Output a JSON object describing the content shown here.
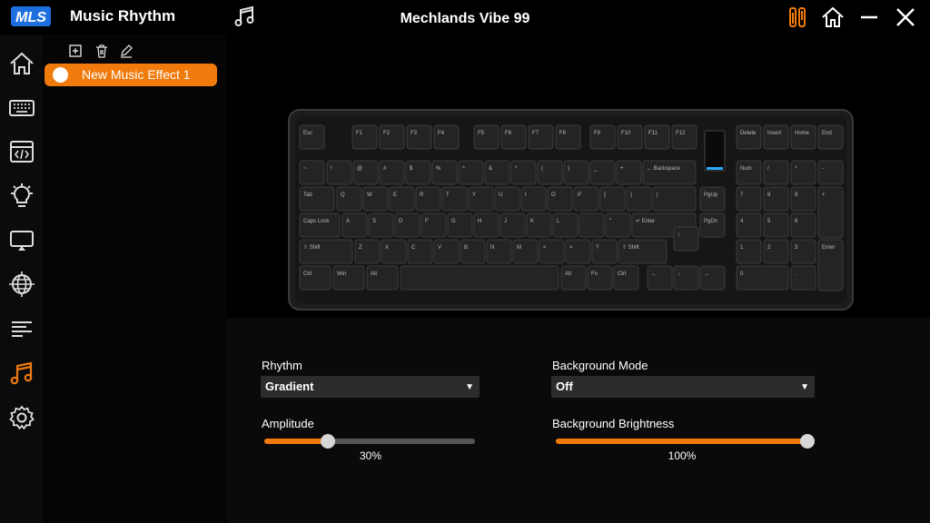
{
  "app": {
    "logo_text": "MLS",
    "title": "Music Rhythm",
    "device_name": "Mechlands Vibe 99"
  },
  "colors": {
    "accent": "#f07a0b",
    "background": "#000000",
    "panel": "#0a0a0a",
    "logo_blue": "#1d6fe0"
  },
  "titlebar": {
    "icons": [
      "music-note-icon",
      "settings-sliders-icon",
      "home-icon",
      "minimize-icon",
      "close-icon"
    ]
  },
  "sidebar": {
    "items": [
      {
        "icon": "home-icon",
        "active": false
      },
      {
        "icon": "keyboard-icon",
        "active": false
      },
      {
        "icon": "macro-code-icon",
        "active": false
      },
      {
        "icon": "light-bulb-icon",
        "active": false
      },
      {
        "icon": "display-icon",
        "active": false
      },
      {
        "icon": "globe-icon",
        "active": false
      },
      {
        "icon": "list-lines-icon",
        "active": false
      },
      {
        "icon": "music-note-icon",
        "active": true
      },
      {
        "icon": "gear-icon",
        "active": false
      }
    ]
  },
  "effects": {
    "tools": [
      "add-icon",
      "delete-icon",
      "edit-icon"
    ],
    "items": [
      {
        "label": "New Music Effect 1",
        "selected": true
      }
    ]
  },
  "keyboard": {
    "rows": [
      [
        "Esc",
        "F1",
        "F2",
        "F3",
        "F4",
        "F5",
        "F6",
        "F7",
        "F8",
        "F9",
        "F10",
        "F11",
        "F12",
        "Delete",
        "Insert",
        "Home",
        "End"
      ],
      [
        "~",
        "!",
        "@",
        "#",
        "$",
        "%",
        "^",
        "&",
        "*",
        "(",
        ")",
        "_",
        "+",
        "← Backspace",
        "Num",
        "/",
        "*",
        "-"
      ],
      [
        "Tab",
        "Q",
        "W",
        "E",
        "R",
        "T",
        "Y",
        "U",
        "I",
        "O",
        "P",
        "{",
        "}",
        "|",
        "PgUp",
        "7",
        "8",
        "9",
        "+"
      ],
      [
        "Caps Lock",
        "A",
        "S",
        "D",
        "F",
        "G",
        "H",
        "J",
        "K",
        "L",
        ":",
        "\"",
        "↵ Enter",
        "PgDn",
        "4",
        "5",
        "6"
      ],
      [
        "⇧ Shift",
        "Z",
        "X",
        "C",
        "V",
        "B",
        "N",
        "M",
        "<",
        ">",
        "?",
        "⇧ Shift",
        "↑",
        "1",
        "2",
        "3",
        "Enter"
      ],
      [
        "Ctrl",
        "Win",
        "Alt",
        "",
        "Alt",
        "Fn",
        "Ctrl",
        "←",
        "↓",
        "→",
        "0",
        "."
      ]
    ]
  },
  "settings": {
    "rhythm": {
      "label": "Rhythm",
      "value": "Gradient"
    },
    "background_mode": {
      "label": "Background Mode",
      "value": "Off"
    },
    "amplitude": {
      "label": "Amplitude",
      "value": 0.3,
      "value_text": "30%"
    },
    "background_brightness": {
      "label": "Background Brightness",
      "value": 1.0,
      "value_text": "100%"
    }
  }
}
